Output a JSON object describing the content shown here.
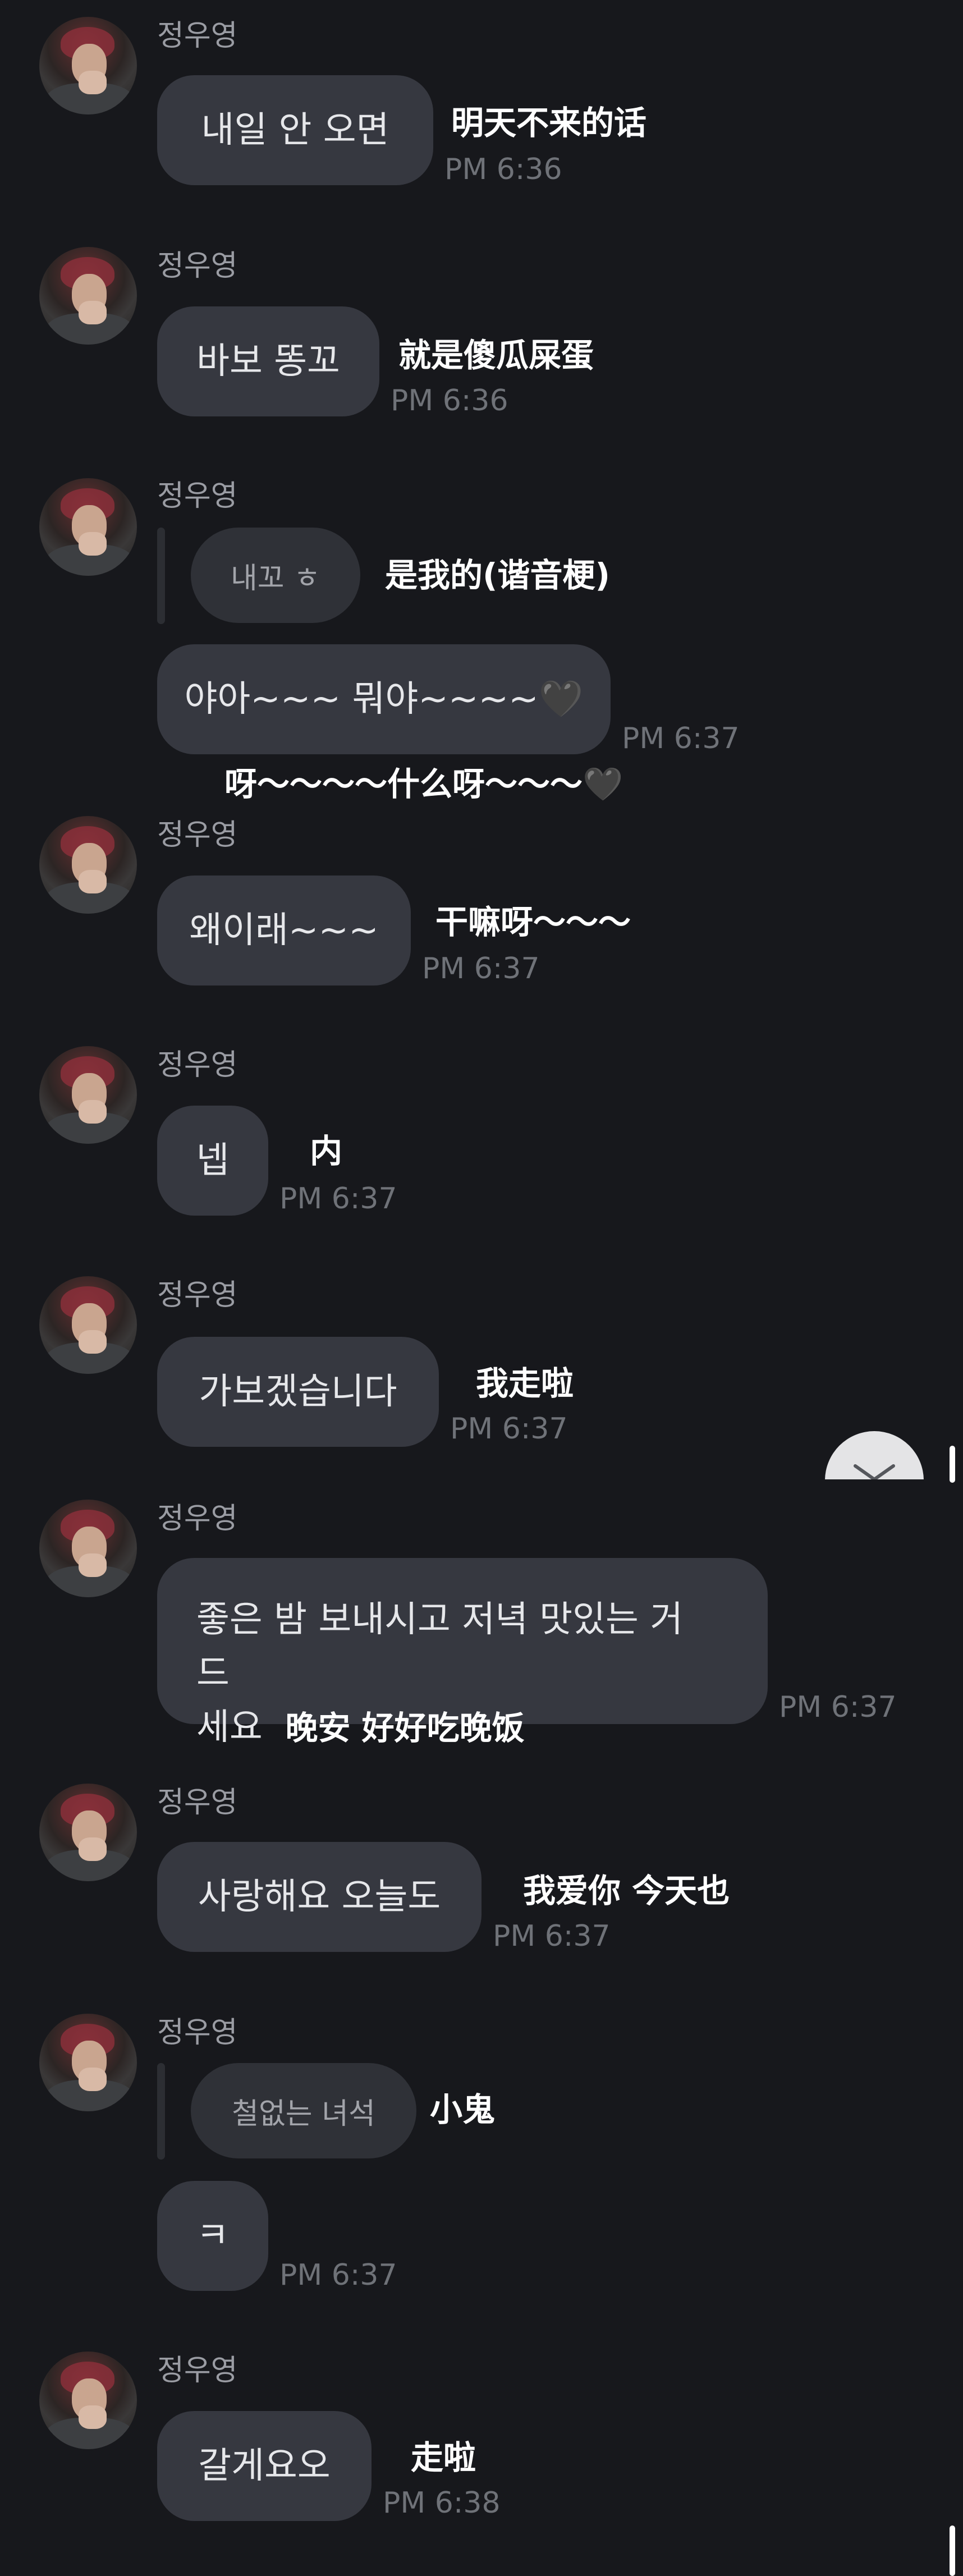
{
  "sender": "정우영",
  "messages": [
    {
      "text": "내일 안 오면",
      "translation": "明天不来的话",
      "time": "PM 6:36"
    },
    {
      "text": "바보 똥꼬",
      "translation": "就是傻瓜屎蛋",
      "time": "PM 6:36"
    },
    {
      "reply": "내꼬 ㅎ",
      "reply_translation": "是我的(谐音梗)",
      "text": "야아~~~ 뭐야~~~~🖤",
      "translation": "呀～～～～什么呀～～～🖤",
      "time": "PM 6:37"
    },
    {
      "text": "왜이래~~~",
      "translation": "干嘛呀～～～",
      "time": "PM 6:37"
    },
    {
      "text": "넵",
      "translation": "内",
      "time": "PM 6:37"
    },
    {
      "text": "가보겠습니다",
      "translation": "我走啦",
      "time": "PM 6:37"
    },
    {
      "text_line1": "좋은 밤 보내시고 저녁 맛있는 거 드",
      "text_line2": "세요",
      "translation": "晚安 好好吃晚饭",
      "time": "PM 6:37"
    },
    {
      "text": "사랑해요 오늘도",
      "translation": "我爱你 今天也",
      "time": "PM 6:37"
    },
    {
      "reply": "철없는 녀석",
      "reply_translation": "小鬼",
      "text": "ㅋ",
      "time": "PM 6:37"
    },
    {
      "text": "갈게요오",
      "translation": "走啦",
      "time": "PM 6:38"
    }
  ],
  "icons": {
    "scroll_down": "chevron-down-icon",
    "avatar": "profile-photo"
  },
  "colors": {
    "background": "#17181c",
    "bubble": "#363840",
    "sender_name": "#9a9ca3",
    "timestamp": "#6f7278"
  }
}
